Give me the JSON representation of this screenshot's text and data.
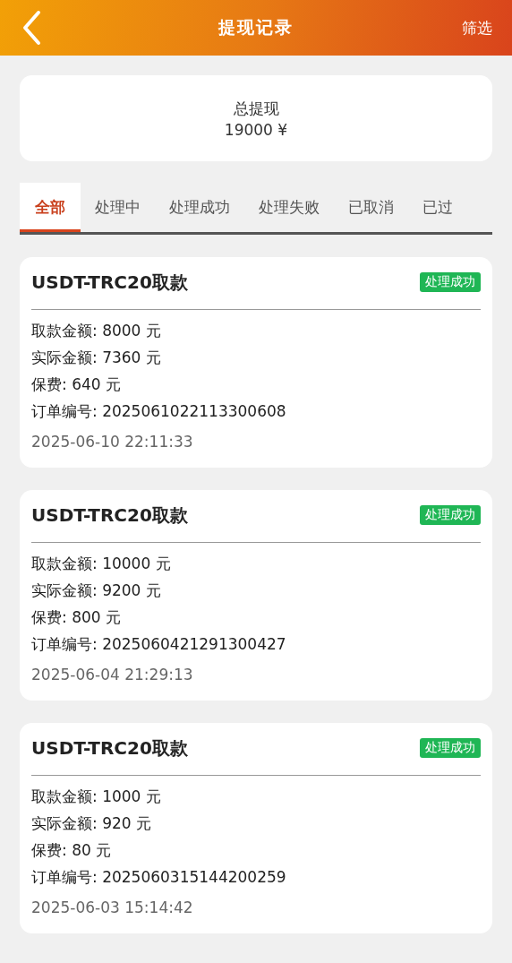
{
  "header": {
    "title": "提现记录",
    "action": "筛选"
  },
  "summary": {
    "label": "总提现",
    "value": "19000 ¥"
  },
  "tabs": [
    {
      "label": "全部",
      "selected": true
    },
    {
      "label": "处理中",
      "selected": false
    },
    {
      "label": "处理成功",
      "selected": false
    },
    {
      "label": "处理失败",
      "selected": false
    },
    {
      "label": "已取消",
      "selected": false
    },
    {
      "label": "已过",
      "selected": false
    }
  ],
  "records": [
    {
      "title": "USDT-TRC20取款",
      "status": "处理成功",
      "kind": "success",
      "fields": [
        "取款金额: 8000 元",
        "实际金额: 7360 元",
        "保费: 640 元",
        "订单编号: 2025061022113300608"
      ],
      "time": "2025-06-10 22:11:33"
    },
    {
      "title": "USDT-TRC20取款",
      "status": "处理成功",
      "kind": "success",
      "fields": [
        "取款金额: 10000 元",
        "实际金额: 9200 元",
        "保费: 800 元",
        "订单编号: 2025060421291300427"
      ],
      "time": "2025-06-04 21:29:13"
    },
    {
      "title": "USDT-TRC20取款",
      "status": "处理成功",
      "kind": "success",
      "fields": [
        "取款金额: 1000 元",
        "实际金额: 920 元",
        "保费: 80 元",
        "订单编号: 2025060315144200259"
      ],
      "time": "2025-06-03 15:14:42"
    }
  ]
}
